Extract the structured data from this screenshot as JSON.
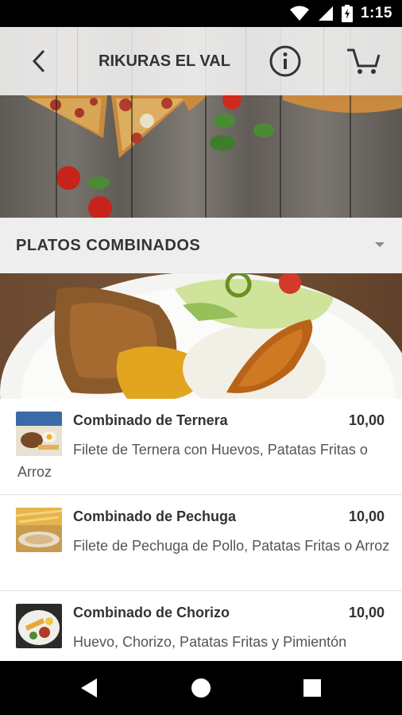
{
  "status_bar": {
    "time": "1:15",
    "icons": [
      "wifi-icon",
      "signal-icon",
      "battery-charging-icon"
    ]
  },
  "header": {
    "title": "RIKURAS EL VAL",
    "back_icon": "back-arrow-icon",
    "info_icon": "info-icon",
    "cart_icon": "cart-icon"
  },
  "category": {
    "title": "PLATOS COMBINADOS",
    "expand_icon": "caret-down-icon"
  },
  "menu": {
    "items": [
      {
        "title": "Combinado de Ternera",
        "price": "10,00",
        "description": "Filete de Ternera con Huevos, Patatas Fritas o Arroz"
      },
      {
        "title": "Combinado de Pechuga",
        "price": "10,00",
        "description": "Filete de Pechuga de Pollo, Patatas Fritas o Arroz"
      },
      {
        "title": "Combinado de Chorizo",
        "price": "10,00",
        "description": "Huevo, Chorizo, Patatas Fritas y Pimientón"
      }
    ]
  },
  "nav": {
    "icons": [
      "nav-back-icon",
      "nav-home-icon",
      "nav-recents-icon"
    ]
  },
  "colors": {
    "text_dark": "#333333",
    "category_bg": "#eeeeee",
    "divider": "#e2e2e2"
  }
}
